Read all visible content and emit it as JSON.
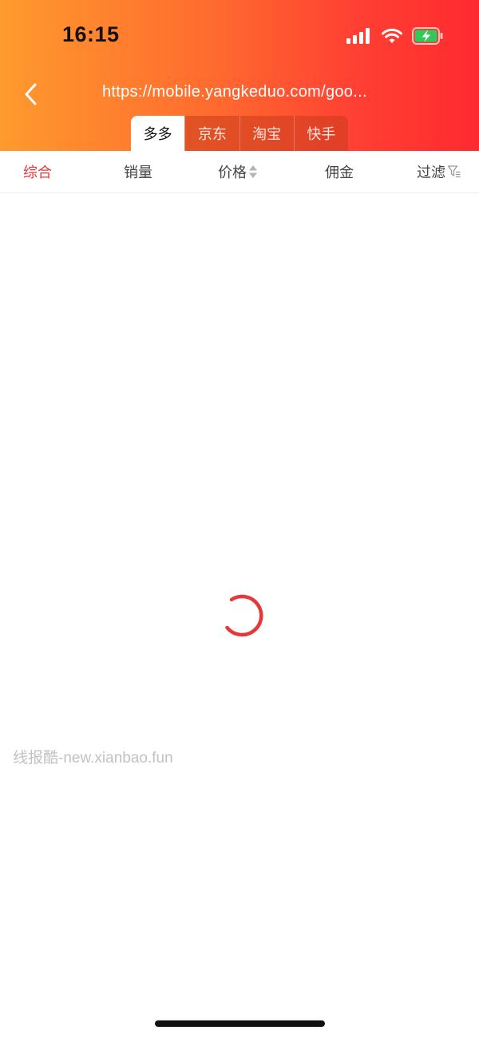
{
  "status_bar": {
    "time": "16:15",
    "icons": [
      "signal-icon",
      "wifi-icon",
      "battery-charging-icon"
    ]
  },
  "header": {
    "url": "https://mobile.yangkeduo.com/goo...",
    "gradient_colors": [
      "#FF9A2E",
      "#FF2A2F"
    ]
  },
  "platform_tabs": [
    {
      "label": "多多",
      "active": true
    },
    {
      "label": "京东",
      "active": false
    },
    {
      "label": "淘宝",
      "active": false
    },
    {
      "label": "快手",
      "active": false
    }
  ],
  "sort_bar": {
    "items": [
      {
        "label": "综合",
        "active": true
      },
      {
        "label": "销量",
        "active": false
      },
      {
        "label": "价格",
        "active": false,
        "icon": "sort-arrows-icon"
      },
      {
        "label": "佣金",
        "active": false
      },
      {
        "label": "过滤",
        "active": false,
        "icon": "filter-icon"
      }
    ],
    "accent_color": "#E5383B"
  },
  "content": {
    "loading": true,
    "watermark": "线报酷-new.xianbao.fun"
  }
}
